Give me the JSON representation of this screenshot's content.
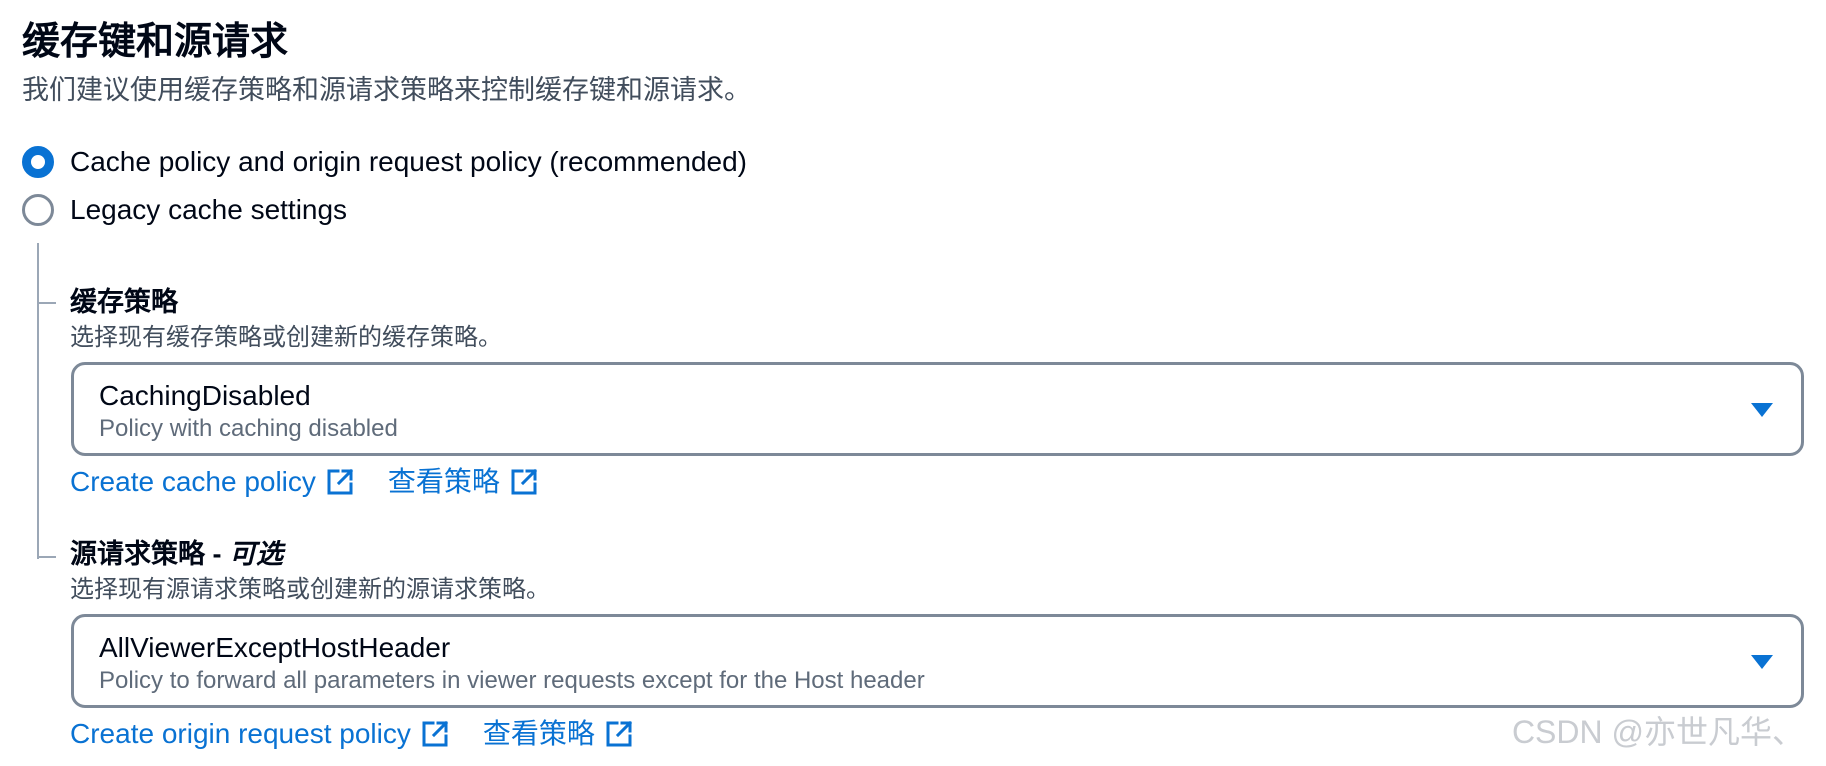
{
  "section": {
    "title": "缓存键和源请求",
    "description": "我们建议使用缓存策略和源请求策略来控制缓存键和源请求。"
  },
  "options": [
    {
      "label": "Cache policy and origin request policy (recommended)",
      "selected": true
    },
    {
      "label": "Legacy cache settings",
      "selected": false
    }
  ],
  "cache_policy": {
    "label": "缓存策略",
    "description": "选择现有缓存策略或创建新的缓存策略。",
    "selected_value": "CachingDisabled",
    "selected_description": "Policy with caching disabled",
    "create_link": "Create cache policy",
    "view_link": "查看策略"
  },
  "origin_request_policy": {
    "label": "源请求策略",
    "dash": " - ",
    "optional": "可选",
    "description": "选择现有源请求策略或创建新的源请求策略。",
    "selected_value": "AllViewerExceptHostHeader",
    "selected_description": "Policy to forward all parameters in viewer requests except for the Host header",
    "create_link": "Create origin request policy",
    "view_link": "查看策略"
  },
  "watermark": "CSDN @亦世凡华、",
  "colors": {
    "link": "#0972d3",
    "radio_selected": "#0972d3",
    "border": "#7d8998",
    "text_primary": "#000716",
    "text_secondary": "#414d5c"
  },
  "icons": {
    "external_link": "external-link-icon",
    "dropdown_caret": "caret-down-icon"
  }
}
